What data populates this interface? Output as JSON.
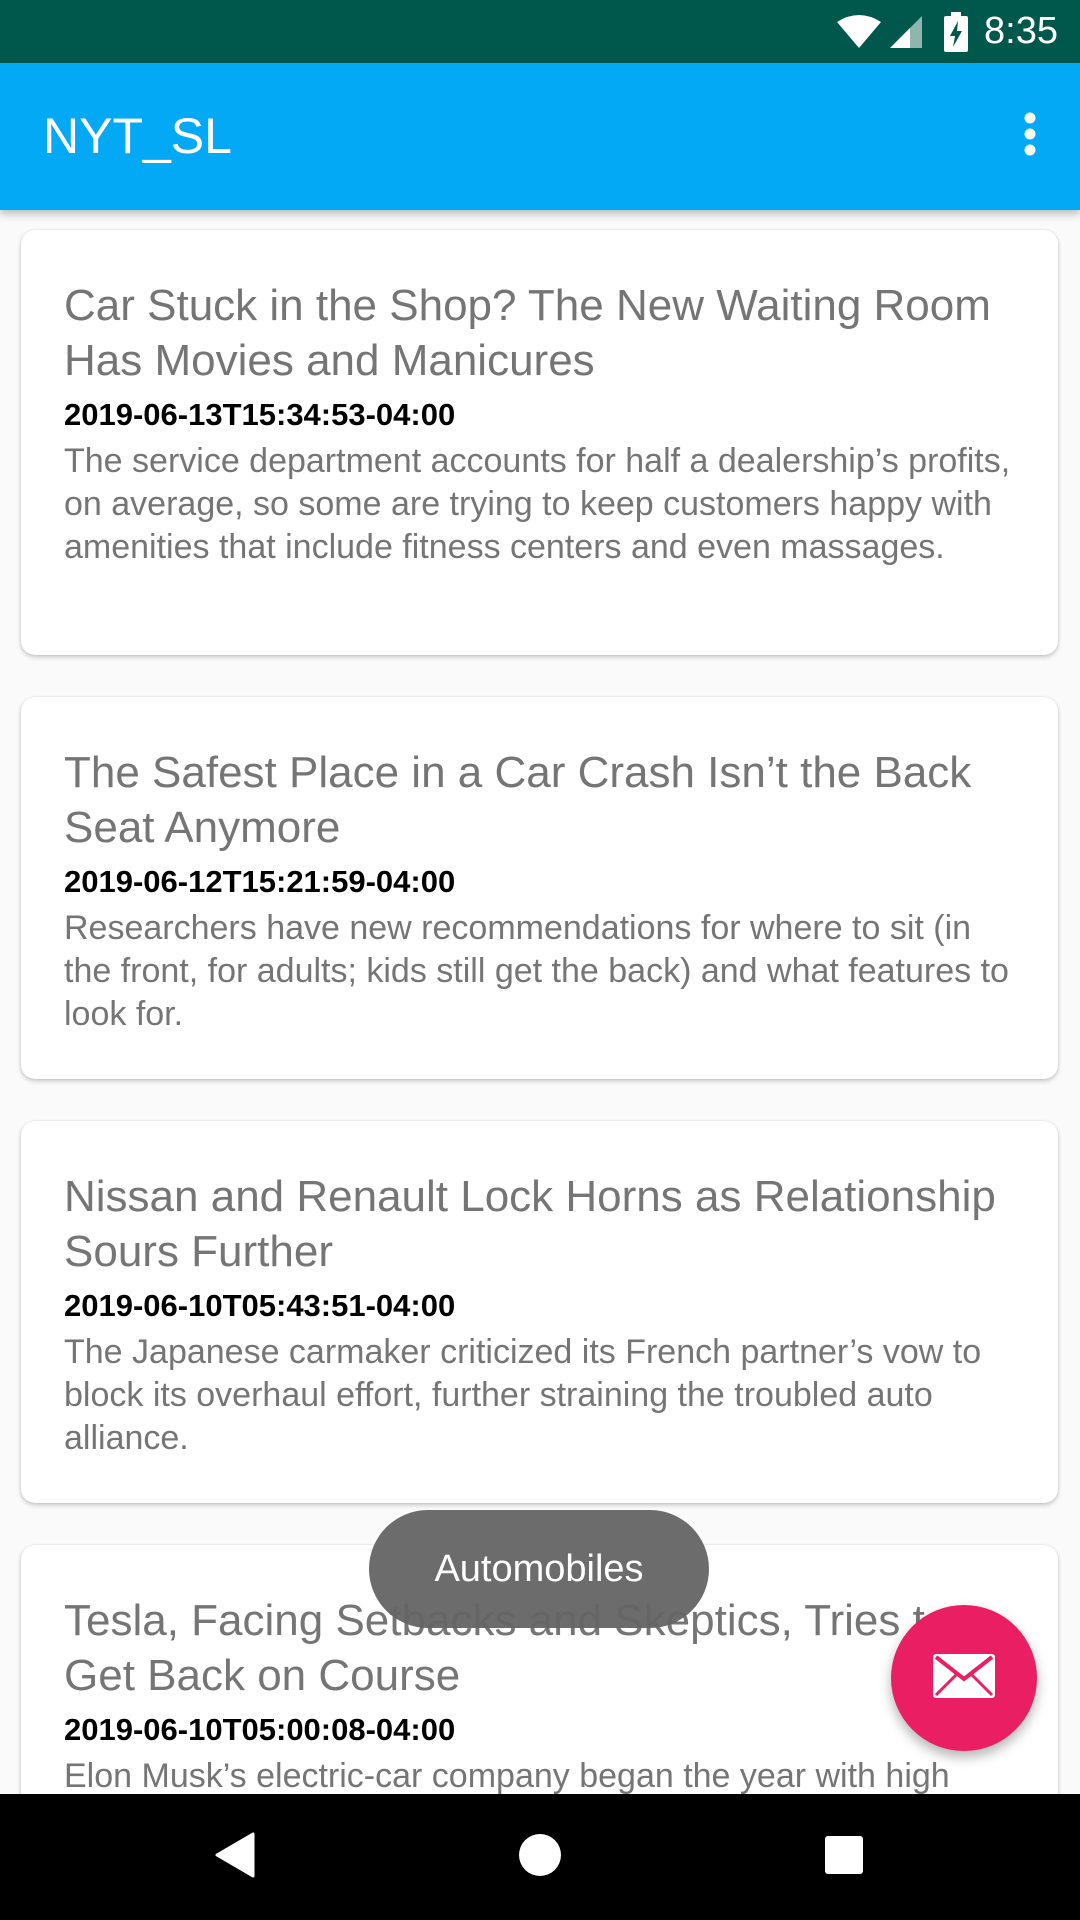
{
  "status_bar": {
    "time": "8:35",
    "icons": [
      "wifi-icon",
      "cell-signal-icon",
      "battery-charging-icon"
    ]
  },
  "app_bar": {
    "title": "NYT_SL",
    "menu_icon": "overflow-menu-icon"
  },
  "articles": [
    {
      "title": "Car Stuck in the Shop? The New Waiting Room Has Movies and Manicures",
      "date": "2019-06-13T15:34:53-04:00",
      "abstract": "The service department accounts for half a dealership’s profits, on average, so some are trying to keep customers happy with amenities that include fitness centers and even massages."
    },
    {
      "title": "The Safest Place in a Car Crash Isn’t the Back Seat Anymore",
      "date": "2019-06-12T15:21:59-04:00",
      "abstract": "Researchers have new recommendations for where to sit (in the front, for adults; kids still get the back) and what features to look for."
    },
    {
      "title": "Nissan and Renault Lock Horns as Relationship Sours Further",
      "date": "2019-06-10T05:43:51-04:00",
      "abstract": "The Japanese carmaker criticized its French partner’s vow to block its overhaul effort, further straining the troubled auto alliance."
    },
    {
      "title": "Tesla, Facing Setbacks and Skeptics, Tries to Get Back on Course",
      "date": "2019-06-10T05:00:08-04:00",
      "abstract": "Elon Musk’s electric-car company began the year with high"
    }
  ],
  "toast": {
    "text": "Automobiles"
  },
  "fab": {
    "icon": "email-icon",
    "color": "#e91e63"
  },
  "nav_bar": {
    "icons": [
      "back-icon",
      "home-icon",
      "recents-icon"
    ]
  },
  "colors": {
    "status_bar": "#00574b",
    "app_bar": "#03a9f4",
    "accent": "#e91e63"
  }
}
